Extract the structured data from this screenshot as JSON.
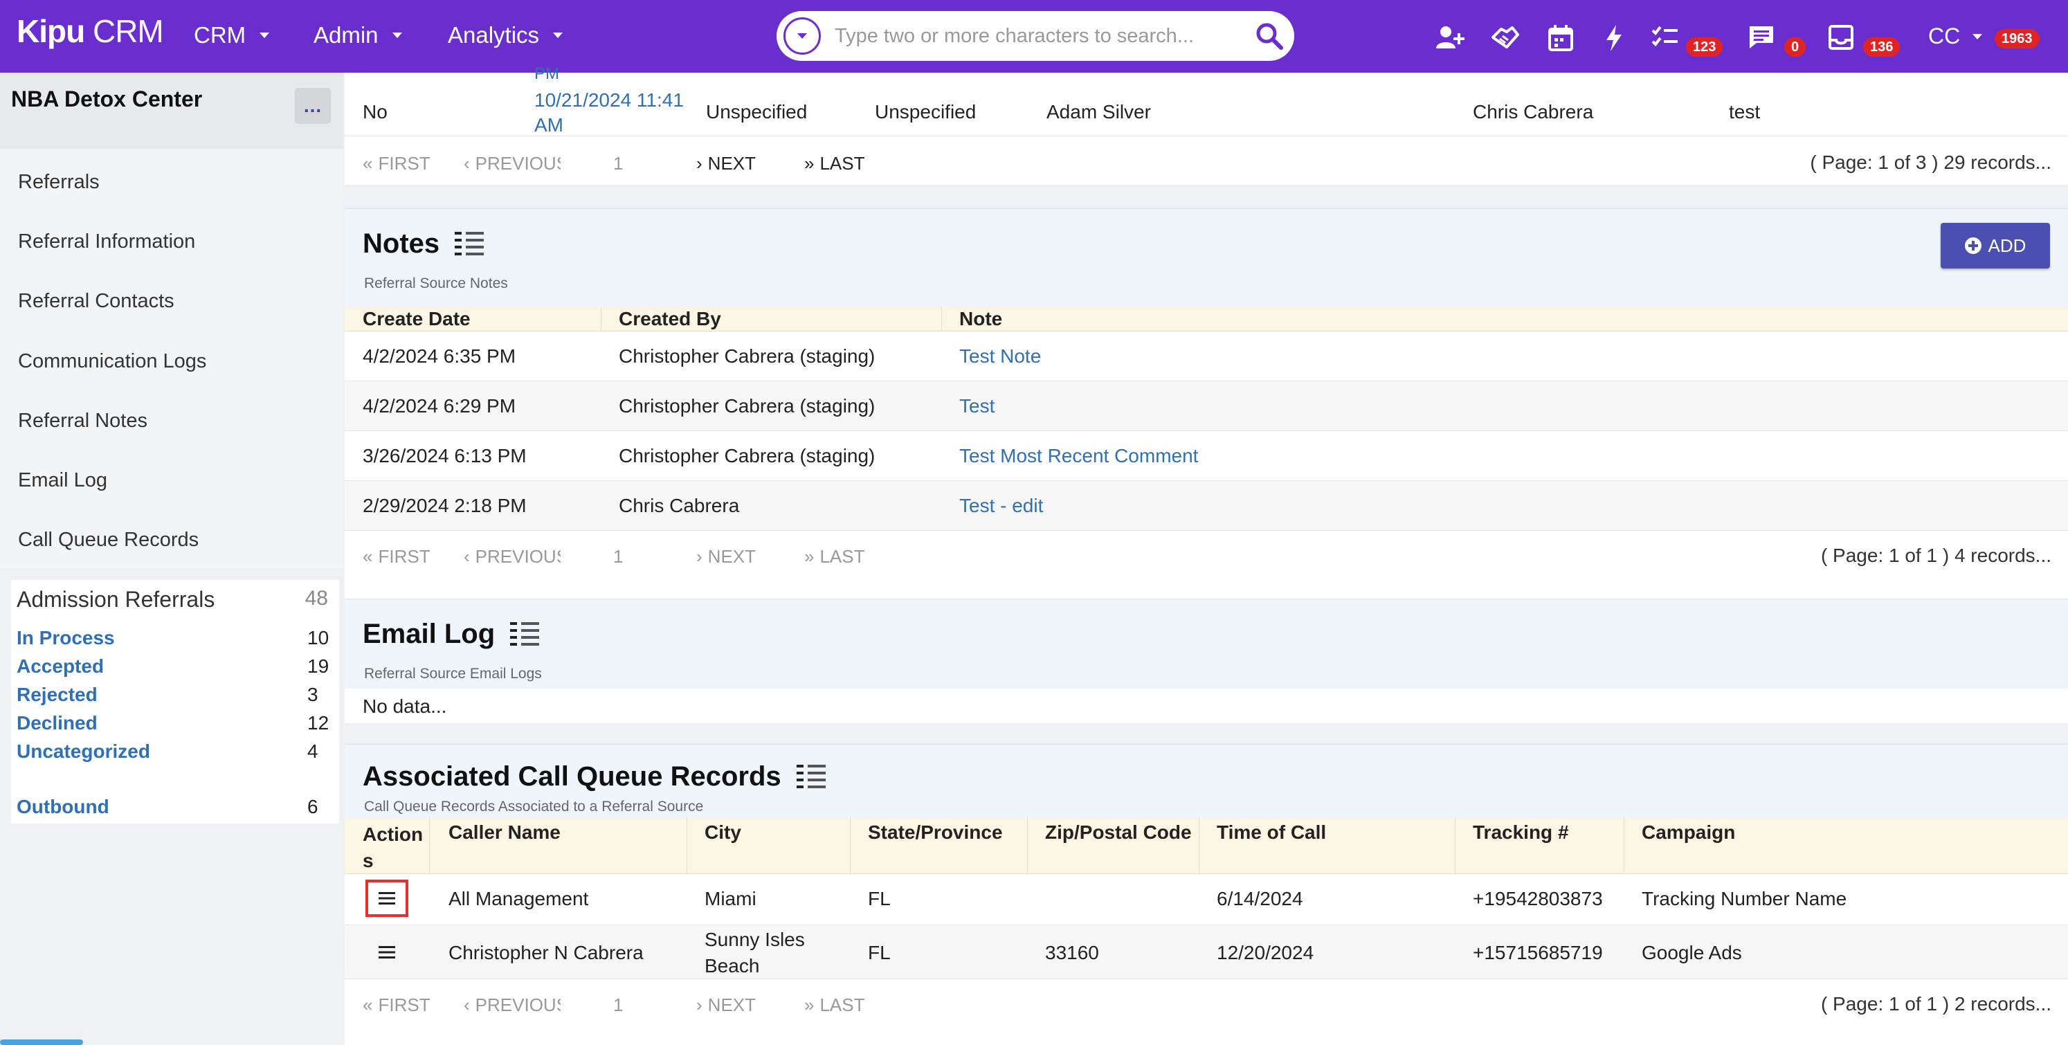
{
  "topbar": {
    "brand_bold": "Kipu",
    "brand_rest": " CRM",
    "nav": [
      "CRM",
      "Admin",
      "Analytics"
    ],
    "search_placeholder": "Type two or more characters to search...",
    "badges": {
      "tasks": "123",
      "messages": "0",
      "inbox": "136",
      "user": "1963"
    },
    "user_initials": "CC"
  },
  "sidebar": {
    "title": "NBA Detox Center",
    "more": "...",
    "items": [
      "Referrals",
      "Referral Information",
      "Referral Contacts",
      "Communication Logs",
      "Referral Notes",
      "Email Log",
      "Call Queue Records"
    ],
    "admissions": {
      "title": "Admission Referrals",
      "total": "48",
      "rows": [
        {
          "label": "In Process",
          "count": "10"
        },
        {
          "label": "Accepted",
          "count": "19"
        },
        {
          "label": "Rejected",
          "count": "3"
        },
        {
          "label": "Declined",
          "count": "12"
        },
        {
          "label": "Uncategorized",
          "count": "4"
        },
        {
          "label": "Outbound",
          "count": "6"
        }
      ]
    }
  },
  "top_table": {
    "partial_above": "PM",
    "row": [
      "No",
      "10/21/2024 11:41 AM",
      "Unspecified",
      "Unspecified",
      "Adam Silver",
      "Chris Cabrera",
      "test"
    ],
    "pager": {
      "first": "FIRST",
      "previous": "PREVIOUS",
      "page": "1",
      "next": "NEXT",
      "last": "LAST",
      "info": "( Page: 1 of 3 ) 29 records..."
    }
  },
  "notes": {
    "title": "Notes",
    "subtitle": "Referral Source Notes",
    "add_label": "ADD",
    "columns": [
      "Create Date",
      "Created By",
      "Note"
    ],
    "rows": [
      [
        "4/2/2024 6:35 PM",
        "Christopher Cabrera (staging)",
        "Test Note"
      ],
      [
        "4/2/2024 6:29 PM",
        "Christopher Cabrera (staging)",
        "Test"
      ],
      [
        "3/26/2024 6:13 PM",
        "Christopher Cabrera (staging)",
        "Test Most Recent Comment"
      ],
      [
        "2/29/2024 2:18 PM",
        "Chris Cabrera",
        "Test - edit"
      ]
    ],
    "pager": {
      "first": "FIRST",
      "previous": "PREVIOUS",
      "page": "1",
      "next": "NEXT",
      "last": "LAST",
      "info": "( Page: 1 of 1 ) 4 records..."
    }
  },
  "email_log": {
    "title": "Email Log",
    "subtitle": "Referral Source Email Logs",
    "empty": "No data..."
  },
  "call_queue": {
    "title": "Associated Call Queue Records",
    "subtitle": "Call Queue Records Associated to a Referral Source",
    "columns": [
      "Action",
      "s",
      "Caller Name",
      "City",
      "State/Province",
      "Zip/Postal Code",
      "Time of Call",
      "Tracking #",
      "Campaign"
    ],
    "rows": [
      {
        "caller": "All Management",
        "city": "Miami",
        "city2": "",
        "state": "FL",
        "zip": "",
        "time": "6/14/2024",
        "tracking": "+19542803873",
        "campaign": "Tracking Number Name"
      },
      {
        "caller": "Christopher N Cabrera",
        "city": "Sunny Isles",
        "city2": "Beach",
        "state": "FL",
        "zip": "33160",
        "time": "12/20/2024",
        "tracking": "+15715685719",
        "campaign": "Google Ads"
      }
    ],
    "pager": {
      "first": "FIRST",
      "previous": "PREVIOUS",
      "page": "1",
      "next": "NEXT",
      "last": "LAST",
      "info": "( Page: 1 of 1 ) 2 records..."
    }
  },
  "colors": {
    "primary": "#6a2ecf",
    "link": "#2f6fb6",
    "badge": "#e02424",
    "button": "#4a4fb0",
    "focus": "#e53030"
  }
}
